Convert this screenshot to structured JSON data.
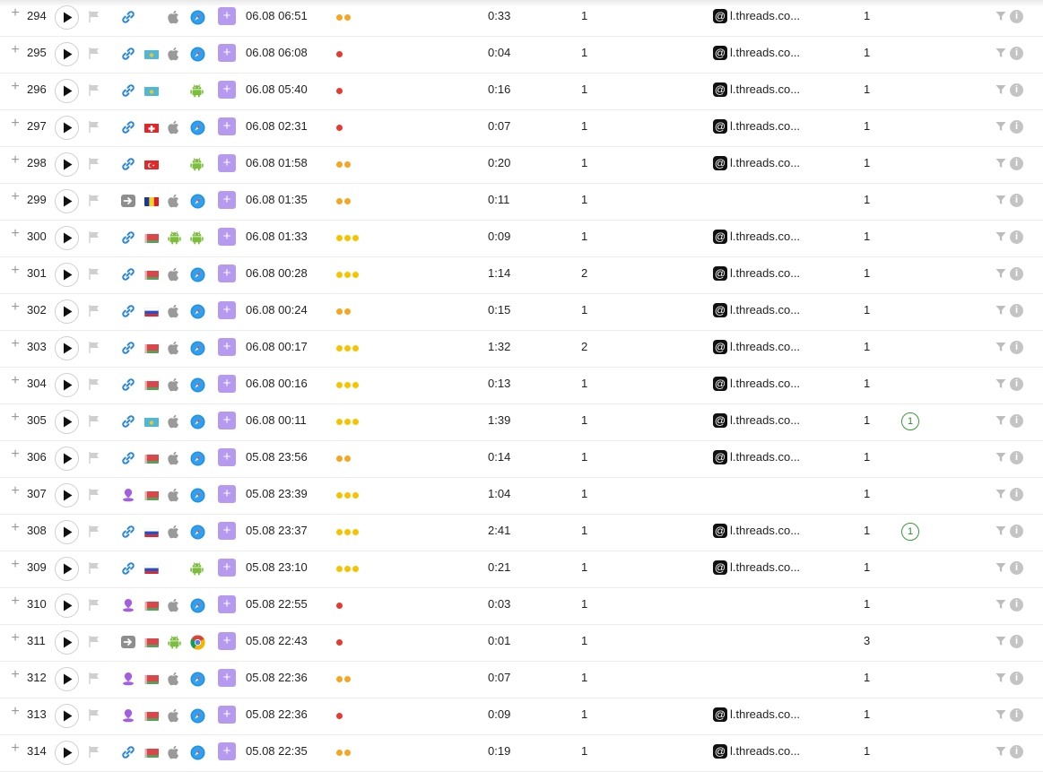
{
  "colors": {
    "accent_purple": "#b69af0",
    "dot_orange": "#f5a623",
    "dot_red": "#e53a2f",
    "dot_yellow": "#f5c400",
    "goal_green": "#2e8a2e"
  },
  "icons": {
    "expand": "plus-icon",
    "play": "play-icon",
    "flag": "flag-icon",
    "filter": "filter-icon",
    "info": "info-icon",
    "referrer": "threads-icon"
  },
  "labels": {
    "expand": "+",
    "add": "+",
    "info": "i",
    "threads_glyph": "@"
  },
  "rows": [
    {
      "num": "294",
      "source": "link",
      "country": "",
      "os": "apple",
      "browser": "safari",
      "datetime": "06.08 06:51",
      "dots": "oo",
      "duration": "0:33",
      "pageviews": "1",
      "referrer": "l.threads.co...",
      "visits": "1",
      "goal": ""
    },
    {
      "num": "295",
      "source": "link",
      "country": "kz",
      "os": "apple",
      "browser": "safari",
      "datetime": "06.08 06:08",
      "dots": "r",
      "duration": "0:04",
      "pageviews": "1",
      "referrer": "l.threads.co...",
      "visits": "1",
      "goal": ""
    },
    {
      "num": "296",
      "source": "link",
      "country": "kz",
      "os": "",
      "browser": "android",
      "datetime": "06.08 05:40",
      "dots": "r",
      "duration": "0:16",
      "pageviews": "1",
      "referrer": "l.threads.co...",
      "visits": "1",
      "goal": ""
    },
    {
      "num": "297",
      "source": "link",
      "country": "ch",
      "os": "apple",
      "browser": "safari",
      "datetime": "06.08 02:31",
      "dots": "r",
      "duration": "0:07",
      "pageviews": "1",
      "referrer": "l.threads.co...",
      "visits": "1",
      "goal": ""
    },
    {
      "num": "298",
      "source": "link",
      "country": "tr",
      "os": "",
      "browser": "android",
      "datetime": "06.08 01:58",
      "dots": "oo",
      "duration": "0:20",
      "pageviews": "1",
      "referrer": "l.threads.co...",
      "visits": "1",
      "goal": ""
    },
    {
      "num": "299",
      "source": "direct",
      "country": "ro",
      "os": "apple",
      "browser": "safari",
      "datetime": "06.08 01:35",
      "dots": "oo",
      "duration": "0:11",
      "pageviews": "1",
      "referrer": "",
      "visits": "1",
      "goal": ""
    },
    {
      "num": "300",
      "source": "link",
      "country": "by",
      "os": "android",
      "browser": "android",
      "datetime": "06.08 01:33",
      "dots": "yyy",
      "duration": "0:09",
      "pageviews": "1",
      "referrer": "l.threads.co...",
      "visits": "1",
      "goal": ""
    },
    {
      "num": "301",
      "source": "link",
      "country": "by",
      "os": "apple",
      "browser": "safari",
      "datetime": "06.08 00:28",
      "dots": "yyy",
      "duration": "1:14",
      "pageviews": "2",
      "referrer": "l.threads.co...",
      "visits": "1",
      "goal": ""
    },
    {
      "num": "302",
      "source": "link",
      "country": "ru",
      "os": "apple",
      "browser": "safari",
      "datetime": "06.08 00:24",
      "dots": "oo",
      "duration": "0:15",
      "pageviews": "1",
      "referrer": "l.threads.co...",
      "visits": "1",
      "goal": ""
    },
    {
      "num": "303",
      "source": "link",
      "country": "by",
      "os": "apple",
      "browser": "safari",
      "datetime": "06.08 00:17",
      "dots": "yyy",
      "duration": "1:32",
      "pageviews": "2",
      "referrer": "l.threads.co...",
      "visits": "1",
      "goal": ""
    },
    {
      "num": "304",
      "source": "link",
      "country": "by",
      "os": "apple",
      "browser": "safari",
      "datetime": "06.08 00:16",
      "dots": "yyy",
      "duration": "0:13",
      "pageviews": "1",
      "referrer": "l.threads.co...",
      "visits": "1",
      "goal": ""
    },
    {
      "num": "305",
      "source": "link",
      "country": "kz",
      "os": "apple",
      "browser": "safari",
      "datetime": "06.08 00:11",
      "dots": "yyy",
      "duration": "1:39",
      "pageviews": "1",
      "referrer": "l.threads.co...",
      "visits": "1",
      "goal": "1"
    },
    {
      "num": "306",
      "source": "link",
      "country": "by",
      "os": "apple",
      "browser": "safari",
      "datetime": "05.08 23:56",
      "dots": "oo",
      "duration": "0:14",
      "pageviews": "1",
      "referrer": "l.threads.co...",
      "visits": "1",
      "goal": ""
    },
    {
      "num": "307",
      "source": "ad",
      "country": "by",
      "os": "apple",
      "browser": "safari",
      "datetime": "05.08 23:39",
      "dots": "yyy",
      "duration": "1:04",
      "pageviews": "1",
      "referrer": "",
      "visits": "1",
      "goal": ""
    },
    {
      "num": "308",
      "source": "link",
      "country": "ru",
      "os": "apple",
      "browser": "safari",
      "datetime": "05.08 23:37",
      "dots": "yyy",
      "duration": "2:41",
      "pageviews": "1",
      "referrer": "l.threads.co...",
      "visits": "1",
      "goal": "1"
    },
    {
      "num": "309",
      "source": "link",
      "country": "ru",
      "os": "",
      "browser": "android",
      "datetime": "05.08 23:10",
      "dots": "yyy",
      "duration": "0:21",
      "pageviews": "1",
      "referrer": "l.threads.co...",
      "visits": "1",
      "goal": ""
    },
    {
      "num": "310",
      "source": "ad",
      "country": "by",
      "os": "apple",
      "browser": "safari",
      "datetime": "05.08 22:55",
      "dots": "r",
      "duration": "0:03",
      "pageviews": "1",
      "referrer": "",
      "visits": "1",
      "goal": ""
    },
    {
      "num": "311",
      "source": "direct",
      "country": "by",
      "os": "android",
      "browser": "chrome",
      "datetime": "05.08 22:43",
      "dots": "r",
      "duration": "0:01",
      "pageviews": "1",
      "referrer": "",
      "visits": "3",
      "goal": ""
    },
    {
      "num": "312",
      "source": "ad",
      "country": "by",
      "os": "apple",
      "browser": "safari",
      "datetime": "05.08 22:36",
      "dots": "oo",
      "duration": "0:07",
      "pageviews": "1",
      "referrer": "",
      "visits": "1",
      "goal": ""
    },
    {
      "num": "313",
      "source": "ad",
      "country": "by",
      "os": "apple",
      "browser": "safari",
      "datetime": "05.08 22:36",
      "dots": "r",
      "duration": "0:09",
      "pageviews": "1",
      "referrer": "l.threads.co...",
      "visits": "1",
      "goal": ""
    },
    {
      "num": "314",
      "source": "link",
      "country": "by",
      "os": "apple",
      "browser": "safari",
      "datetime": "05.08 22:35",
      "dots": "oo",
      "duration": "0:19",
      "pageviews": "1",
      "referrer": "l.threads.co...",
      "visits": "1",
      "goal": ""
    }
  ]
}
